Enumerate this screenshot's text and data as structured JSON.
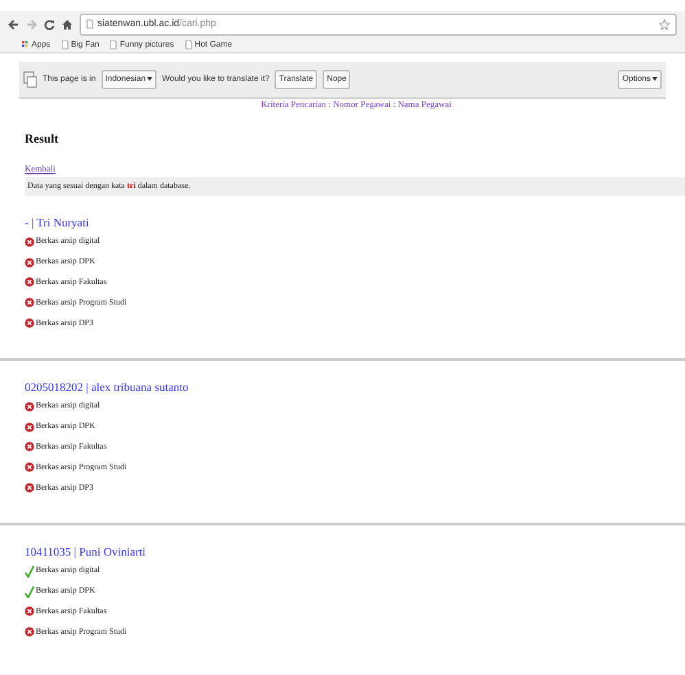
{
  "browser": {
    "url_host": "siatenwan.ubl.ac.id",
    "url_path": "/cari.php",
    "bookmarks": [
      "Apps",
      "Big Fan",
      "Funny pictures",
      "Hot Game"
    ]
  },
  "translate_bar": {
    "text_before": "This page is in",
    "language": "Indonesian",
    "question": "Would you like to translate it?",
    "buttons": [
      "Translate",
      "Nope"
    ],
    "options": "Options"
  },
  "page": {
    "nav_links": "Kriteria Pencarian : Nomor Pegawai : Nama Pegawai",
    "heading": "Result",
    "back_link": "Kembali",
    "notice": "Data yang sesuai dengan kata **tri** dalam database.",
    "results": [
      {
        "title": "- | Tri Nuryati",
        "items": [
          {
            "label": "Berkas arsip digital",
            "kind": "missing"
          },
          {
            "label": "Berkas arsip DPK",
            "kind": "missing"
          },
          {
            "label": "Berkas arsip Fakultas",
            "kind": "missing"
          },
          {
            "label": "Berkas arsip Program Studi",
            "kind": "missing"
          },
          {
            "label": "Berkas arsip DP3",
            "kind": "missing"
          }
        ]
      },
      {
        "title": "0205018202 | alex tribuana sutanto",
        "items": [
          {
            "label": "Berkas arsip digital",
            "kind": "missing"
          },
          {
            "label": "Berkas arsip DPK",
            "kind": "missing"
          },
          {
            "label": "Berkas arsip Fakultas",
            "kind": "missing"
          },
          {
            "label": "Berkas arsip Program Studi",
            "kind": "missing"
          },
          {
            "label": "Berkas arsip DP3",
            "kind": "missing"
          }
        ]
      },
      {
        "title": "10411035 | Puni Oviniarti",
        "items": [
          {
            "label": "Berkas arsip digital",
            "kind": "ok"
          },
          {
            "label": "Berkas arsip DPK",
            "kind": "ok"
          },
          {
            "label": "Berkas arsip Fakultas",
            "kind": "missing"
          },
          {
            "label": "Berkas arsip Program Studi",
            "kind": "missing"
          }
        ]
      }
    ]
  }
}
